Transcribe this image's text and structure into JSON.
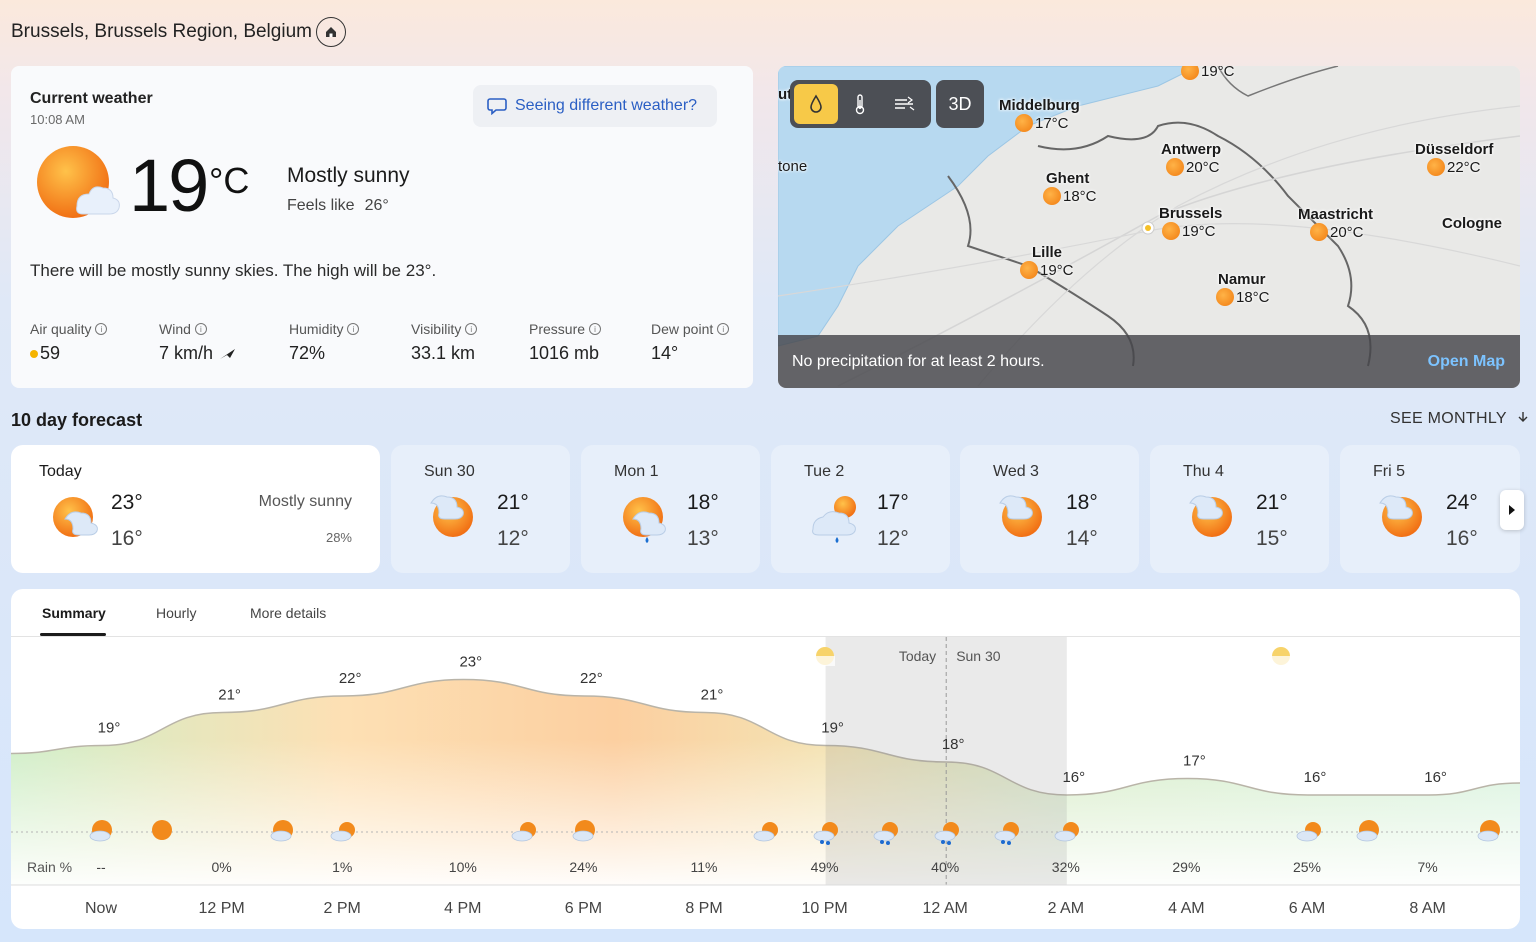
{
  "header": {
    "location": "Brussels, Brussels Region, Belgium",
    "home_icon": "home-icon"
  },
  "current": {
    "title": "Current weather",
    "time": "10:08 AM",
    "feedback_label": "Seeing different weather?",
    "temp": "19",
    "unit": "°C",
    "condition": "Mostly sunny",
    "feels_label": "Feels like",
    "feels_value": "26°",
    "summary": "There will be mostly sunny skies. The high will be 23°.",
    "metrics": [
      {
        "label": "Air quality",
        "value": "59"
      },
      {
        "label": "Wind",
        "value": "7 km/h"
      },
      {
        "label": "Humidity",
        "value": "72%"
      },
      {
        "label": "Visibility",
        "value": "33.1 km"
      },
      {
        "label": "Pressure",
        "value": "1016 mb"
      },
      {
        "label": "Dew point",
        "value": "14°"
      }
    ]
  },
  "map": {
    "btn_3d": "3D",
    "status": "No precipitation for at least 2 hours.",
    "open_label": "Open Map",
    "cut_labels": [
      "uth",
      "tone"
    ],
    "cities": [
      {
        "name": "",
        "temp": "19°C"
      },
      {
        "name": "Middelburg",
        "temp": "17°C"
      },
      {
        "name": "Antwerp",
        "temp": "20°C"
      },
      {
        "name": "Düsseldorf",
        "temp": "22°C"
      },
      {
        "name": "Ghent",
        "temp": "18°C"
      },
      {
        "name": "Brussels",
        "temp": "19°C"
      },
      {
        "name": "Maastricht",
        "temp": "20°C"
      },
      {
        "name": "Cologne",
        "temp": ""
      },
      {
        "name": "Lille",
        "temp": "19°C"
      },
      {
        "name": "Namur",
        "temp": "18°C"
      }
    ]
  },
  "forecast": {
    "title": "10 day forecast",
    "see_monthly": "SEE MONTHLY",
    "days": [
      {
        "name": "Today",
        "hi": "23°",
        "lo": "16°",
        "cond": "Mostly sunny",
        "pct": "28%"
      },
      {
        "name": "Sun 30",
        "hi": "21°",
        "lo": "12°"
      },
      {
        "name": "Mon 1",
        "hi": "18°",
        "lo": "13°"
      },
      {
        "name": "Tue 2",
        "hi": "17°",
        "lo": "12°"
      },
      {
        "name": "Wed 3",
        "hi": "18°",
        "lo": "14°"
      },
      {
        "name": "Thu 4",
        "hi": "21°",
        "lo": "15°"
      },
      {
        "name": "Fri 5",
        "hi": "24°",
        "lo": "16°"
      }
    ]
  },
  "details": {
    "tabs": [
      "Summary",
      "Hourly",
      "More details"
    ],
    "rain_label": "Rain %",
    "today_label": "Today",
    "next_day_label": "Sun 30"
  },
  "chart_data": {
    "type": "area",
    "x": [
      "Now",
      "12 PM",
      "2 PM",
      "4 PM",
      "6 PM",
      "8 PM",
      "10 PM",
      "12 AM",
      "2 AM",
      "4 AM",
      "6 AM",
      "8 AM"
    ],
    "temps": [
      19,
      21,
      22,
      23,
      22,
      21,
      19,
      18,
      16,
      17,
      16,
      16
    ],
    "temp_labels": [
      "19°",
      "21°",
      "22°",
      "23°",
      "22°",
      "21°",
      "19°",
      "18°",
      "16°",
      "17°",
      "16°",
      "16°"
    ],
    "rain_pct": [
      "--",
      "0%",
      "1%",
      "10%",
      "24%",
      "11%",
      "49%",
      "40%",
      "32%",
      "29%",
      "25%",
      "7%"
    ],
    "ylim": [
      10,
      30
    ],
    "night_band": [
      "10 PM",
      "2 AM"
    ]
  }
}
